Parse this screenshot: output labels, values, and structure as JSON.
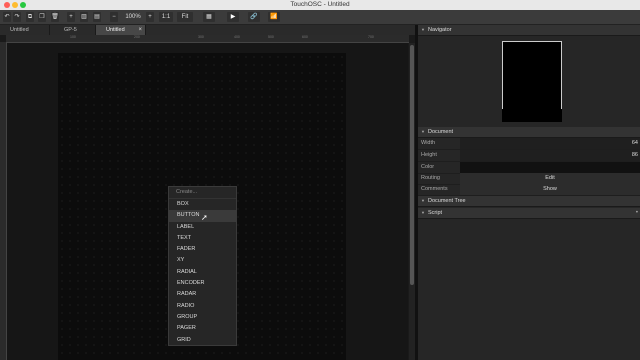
{
  "window": {
    "title": "TouchOSC - Untitled",
    "traffic_colors": [
      "#ff5f57",
      "#febc2e",
      "#28c840"
    ]
  },
  "toolbar": {
    "undo_icon": "↶",
    "redo_icon": "↷",
    "copy_icon": "⧉",
    "paste_icon": "❐",
    "delete_icon": "🗑",
    "add_icon": "+",
    "zoom_out": "−",
    "zoom_value": "100%",
    "zoom_in": "+",
    "one_to_one": "1:1",
    "fit": "Fit",
    "grid_icon": "▦",
    "play_icon": "▶",
    "link_icon": "🔗",
    "wifi_icon": "📶"
  },
  "tabs": [
    {
      "label": "Untitled"
    },
    {
      "label": "GP-5"
    },
    {
      "label": "Untitled",
      "close": "×"
    }
  ],
  "ruler": {
    "ticks": [
      "100",
      "200",
      "300",
      "400",
      "500",
      "600",
      "700"
    ]
  },
  "context_menu": {
    "header": "Create...",
    "items": [
      "BOX",
      "BUTTON",
      "LABEL",
      "TEXT",
      "FADER",
      "XY",
      "RADIAL",
      "ENCODER",
      "RADAR",
      "RADIO",
      "GROUP",
      "PAGER",
      "GRID"
    ],
    "hovered": "BUTTON"
  },
  "panel": {
    "navigator": {
      "title": "Navigator"
    },
    "document": {
      "title": "Document",
      "width_label": "Width",
      "width_value": "64",
      "height_label": "Height",
      "height_value": "86",
      "color_label": "Color",
      "routing_label": "Routing",
      "routing_button": "Edit",
      "comments_label": "Comments",
      "comments_button": "Show"
    },
    "document_tree": {
      "title": "Document Tree"
    },
    "script": {
      "title": "Script",
      "dots": "•"
    }
  }
}
